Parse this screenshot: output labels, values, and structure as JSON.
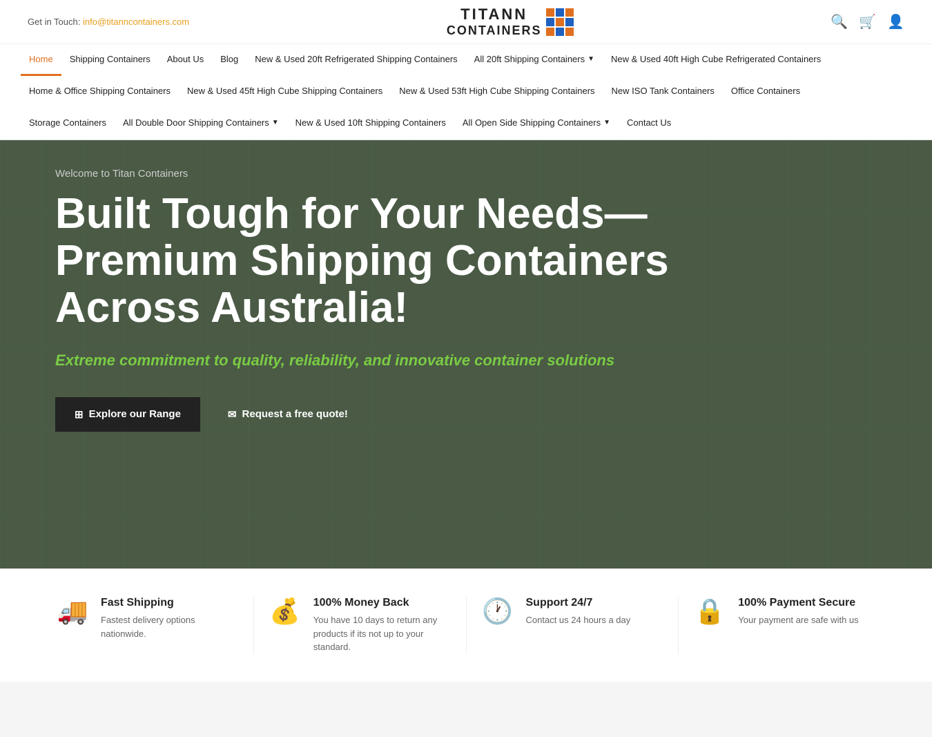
{
  "topbar": {
    "contact_label": "Get in Touch:",
    "email": "info@titanncontainers.com",
    "logo_line1": "TITANN",
    "logo_line2": "CONTAINERS"
  },
  "nav": {
    "row1": [
      {
        "id": "home",
        "label": "Home",
        "active": true,
        "has_arrow": false
      },
      {
        "id": "shipping-containers",
        "label": "Shipping Containers",
        "active": false,
        "has_arrow": false
      },
      {
        "id": "about-us",
        "label": "About Us",
        "active": false,
        "has_arrow": false
      },
      {
        "id": "blog",
        "label": "Blog",
        "active": false,
        "has_arrow": false
      },
      {
        "id": "new-used-20ft-refrig",
        "label": "New & Used 20ft Refrigerated Shipping Containers",
        "active": false,
        "has_arrow": false
      },
      {
        "id": "all-20ft",
        "label": "All 20ft Shipping Containers",
        "active": false,
        "has_arrow": true
      },
      {
        "id": "new-used-40ft-hc-refrig",
        "label": "New & Used 40ft High Cube Refrigerated Containers",
        "active": false,
        "has_arrow": false
      }
    ],
    "row2": [
      {
        "id": "home-office",
        "label": "Home & Office Shipping Containers",
        "active": false,
        "has_arrow": false
      },
      {
        "id": "new-used-45ft",
        "label": "New & Used 45ft High Cube Shipping Containers",
        "active": false,
        "has_arrow": false
      },
      {
        "id": "new-used-53ft",
        "label": "New & Used 53ft High Cube Shipping Containers",
        "active": false,
        "has_arrow": false
      },
      {
        "id": "new-iso-tank",
        "label": "New ISO Tank Containers",
        "active": false,
        "has_arrow": false
      },
      {
        "id": "office-containers",
        "label": "Office Containers",
        "active": false,
        "has_arrow": false
      }
    ],
    "row3": [
      {
        "id": "storage-containers",
        "label": "Storage Containers",
        "active": false,
        "has_arrow": false
      },
      {
        "id": "all-double-door",
        "label": "All Double Door Shipping Containers",
        "active": false,
        "has_arrow": true
      },
      {
        "id": "new-used-10ft",
        "label": "New & Used 10ft Shipping Containers",
        "active": false,
        "has_arrow": false
      },
      {
        "id": "all-open-side",
        "label": "All Open Side Shipping Containers",
        "active": false,
        "has_arrow": true
      },
      {
        "id": "contact-us",
        "label": "Contact Us",
        "active": false,
        "has_arrow": false
      }
    ]
  },
  "hero": {
    "welcome": "Welcome to Titan Containers",
    "title": "Built Tough for Your Needs—Premium Shipping Containers Across Australia!",
    "subtitle": "Extreme commitment to quality, reliability, and innovative container solutions",
    "btn_explore": "Explore our Range",
    "btn_quote": "Request a free quote!"
  },
  "features": [
    {
      "id": "fast-shipping",
      "icon": "🚚",
      "title": "Fast Shipping",
      "description": "Fastest delivery options nationwide."
    },
    {
      "id": "money-back",
      "icon": "💰",
      "title": "100% Money Back",
      "description": "You have 10 days to return any products if its not up to your standard."
    },
    {
      "id": "support-247",
      "icon": "🕐",
      "title": "Support 24/7",
      "description": "Contact us 24 hours a day"
    },
    {
      "id": "payment-secure",
      "icon": "🔒",
      "title": "100% Payment Secure",
      "description": "Your payment are safe with us"
    }
  ]
}
